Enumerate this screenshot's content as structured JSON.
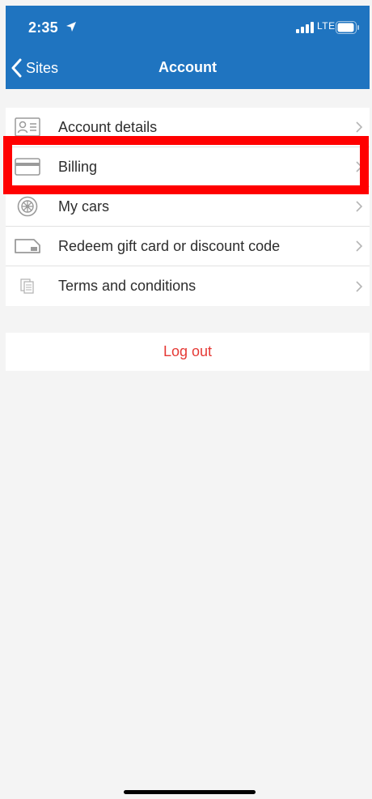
{
  "status_bar": {
    "time": "2:35",
    "network": "LTE"
  },
  "nav": {
    "back_label": "Sites",
    "title": "Account"
  },
  "menu": {
    "items": [
      {
        "label": "Account details",
        "icon": "id-card-icon"
      },
      {
        "label": "Billing",
        "icon": "credit-card-icon"
      },
      {
        "label": "My cars",
        "icon": "wheel-icon"
      },
      {
        "label": "Redeem gift card or discount code",
        "icon": "gift-card-icon"
      },
      {
        "label": "Terms and conditions",
        "icon": "document-icon"
      }
    ]
  },
  "logout": {
    "label": "Log out"
  },
  "colors": {
    "header": "#1f74c0",
    "logout_text": "#e53935",
    "highlight": "#ff0000"
  }
}
